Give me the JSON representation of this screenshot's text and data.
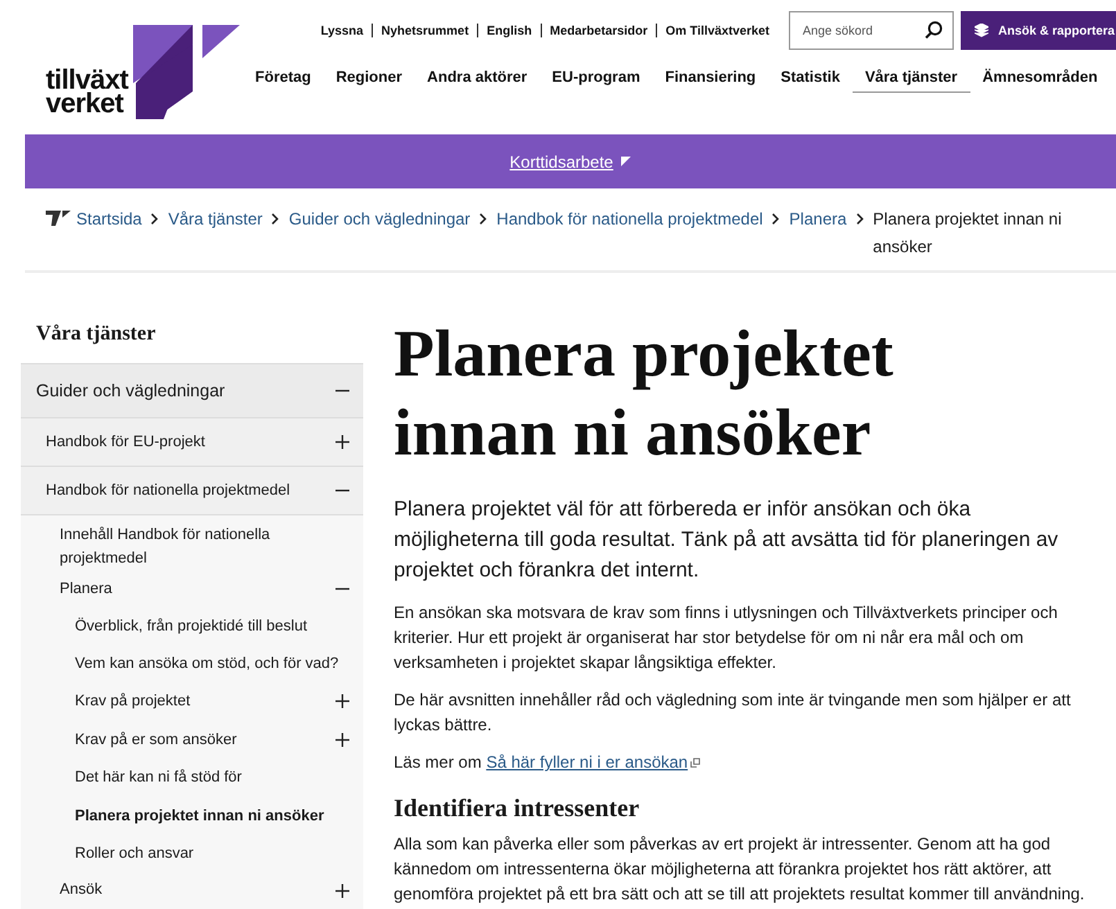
{
  "header": {
    "logo": {
      "lines": [
        "tillväxt",
        "verket"
      ]
    },
    "utility_links": [
      "Lyssna",
      "Nyhetsrummet",
      "English",
      "Medarbetarsidor",
      "Om Tillväxtverket"
    ],
    "search": {
      "placeholder": "Ange sökord"
    },
    "action_button": "Ansök & rapportera",
    "nav": [
      {
        "label": "Företag",
        "selected": false
      },
      {
        "label": "Regioner",
        "selected": false
      },
      {
        "label": "Andra aktörer",
        "selected": false
      },
      {
        "label": "EU-program",
        "selected": false
      },
      {
        "label": "Finansiering",
        "selected": false
      },
      {
        "label": "Statistik",
        "selected": false
      },
      {
        "label": "Våra tjänster",
        "selected": true
      },
      {
        "label": "Ämnesområden",
        "selected": false
      }
    ]
  },
  "notice_bar": {
    "link": "Korttidsarbete"
  },
  "breadcrumb": [
    {
      "label": "Startsida",
      "current": false
    },
    {
      "label": "Våra tjänster",
      "current": false
    },
    {
      "label": "Guider och vägledningar",
      "current": false
    },
    {
      "label": "Handbok för nationella projektmedel",
      "current": false
    },
    {
      "label": "Planera",
      "current": false
    },
    {
      "label": "Planera projektet innan ni ansöker",
      "current": true
    }
  ],
  "sidebar": {
    "title": "Våra tjänster",
    "items": [
      {
        "label": "Guider och vägledningar",
        "selected": false,
        "expanded": true,
        "children": [
          {
            "label": "Handbok för EU-projekt",
            "selected": false,
            "expanded": false
          },
          {
            "label": "Handbok för nationella projektmedel",
            "selected": false,
            "expanded": true,
            "children": [
              {
                "label": "Innehåll Handbok för nationella projektmedel",
                "selected": false
              },
              {
                "label": "Planera",
                "selected": false,
                "expanded": true,
                "children": [
                  {
                    "label": "Överblick, från projektidé till beslut",
                    "selected": false
                  },
                  {
                    "label": "Vem kan ansöka om stöd, och för vad?",
                    "selected": false
                  },
                  {
                    "label": "Krav på projektet",
                    "selected": false,
                    "expanded": false
                  },
                  {
                    "label": "Krav på er som ansöker",
                    "selected": false,
                    "expanded": false
                  },
                  {
                    "label": "Det här kan ni få stöd för",
                    "selected": false
                  },
                  {
                    "label": "Planera projektet innan ni ansöker",
                    "selected": true
                  },
                  {
                    "label": "Roller och ansvar",
                    "selected": false
                  }
                ]
              },
              {
                "label": "Ansök",
                "selected": false,
                "expanded": false
              }
            ]
          }
        ]
      }
    ]
  },
  "article": {
    "title": "Planera projektet innan ni ansöker",
    "lead": "Planera projektet väl för att förbereda er inför ansökan och öka möjligheterna till goda resultat. Tänk på att avsätta tid för planeringen av projektet och förankra det internt.",
    "blocks": [
      {
        "kind": "paragraph",
        "text": "En ansökan ska motsvara de krav som finns i utlysningen och Tillväxtverkets principer och kriterier. Hur ett projekt är organiserat har stor betydelse för om ni når era mål och om verksamheten i projektet skapar långsiktiga effekter."
      },
      {
        "kind": "paragraph",
        "text": "De här avsnitten innehåller råd och vägledning som inte är tvingande men som hjälper er att lyckas bättre."
      },
      {
        "kind": "link_paragraph",
        "text": "Läs mer om ",
        "link": "Så här fyller ni i er ansökan"
      },
      {
        "kind": "heading",
        "text": "Identifiera intressenter"
      },
      {
        "kind": "paragraph",
        "text": "Alla som kan påverka eller som påverkas av ert projekt är intressenter. Genom att ha god kännedom om intressenterna ökar möjligheterna att förankra projektet hos rätt aktörer, att genomföra projektet på ett bra sätt och att se till att projektets resultat kommer till användning."
      }
    ]
  }
}
